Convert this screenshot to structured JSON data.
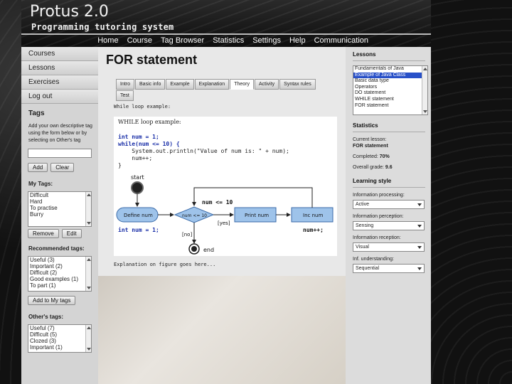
{
  "header": {
    "title": "Protus 2.0",
    "subtitle": "Programming tutoring system",
    "nav": [
      "Home",
      "Course",
      "Tag Browser",
      "Statistics",
      "Settings",
      "Help",
      "Communication"
    ]
  },
  "left_nav": [
    "Courses",
    "Lessons",
    "Exercises",
    "Log out"
  ],
  "tags": {
    "title": "Tags",
    "description": "Add your own descriptive tag using the form below or by selecting on Other's tag",
    "add_label": "Add",
    "clear_label": "Clear",
    "my_tags_title": "My Tags:",
    "my_tags": [
      "Difficult",
      "Hard",
      "To practise",
      "Burry"
    ],
    "remove_label": "Remove",
    "edit_label": "Edit",
    "recommended_title": "Recommended tags:",
    "recommended": [
      "Useful (3)",
      "Important (2)",
      "Difficult (2)",
      "Good examples (1)",
      "To part (1)"
    ],
    "add_to_my_tags_label": "Add to My tags",
    "others_title": "Other's tags:",
    "others": [
      "Useful (7)",
      "Difficult (5)",
      "Clozed (3)",
      "Important (1)"
    ]
  },
  "main": {
    "title": "FOR statement",
    "tabs": [
      "Intro",
      "Basic info",
      "Example",
      "Explanation",
      "Theory",
      "Activity",
      "Syntax rules",
      "Test"
    ],
    "active_tab": "Theory",
    "code_label": "While loop example:",
    "panel_title": "WHILE loop example:",
    "code_lines": [
      "int num = 1;",
      "while(num <= 10) {",
      "    System.out.println(\"Value of num is: \" + num);",
      "    num++;",
      "}"
    ],
    "diagram": {
      "start": "start",
      "end": "end",
      "define_node": "Define num",
      "condition_node": "num <= 10",
      "print_node": "Print num",
      "inc_node": "Inc num",
      "cond_annotation": "num <= 10",
      "yes_label": "[yes]",
      "no_label": "[no]",
      "init_code": "int num = 1;",
      "inc_code": "num++;"
    },
    "explanation": "Explanation on figure goes here..."
  },
  "right": {
    "lessons_title": "Lessons",
    "lessons": [
      "Fundamentals of Java",
      "Example of Java Class",
      "Basic data type",
      "Operators",
      "DO statement",
      "WHILE statement",
      "FOR statement"
    ],
    "selected_lesson": "Example of Java Class",
    "stats_title": "Statistics",
    "current_lesson_label": "Current lesson:",
    "current_lesson": "FOR statement",
    "completed_label": "Completed:",
    "completed_value": "70%",
    "grade_label": "Overall grade:",
    "grade_value": "9.6",
    "style_title": "Learning style",
    "processing_label": "Information processing:",
    "processing_value": "Active",
    "perception_label": "Information perception:",
    "perception_value": "Sensing",
    "reception_label": "Information reception:",
    "reception_value": "Visual",
    "understanding_label": "Inf. understanding:",
    "understanding_value": "Sequential"
  },
  "colors": {
    "accent_blue": "#2850c8",
    "node_fill": "#9ec3ea",
    "node_stroke": "#3a6aa8"
  }
}
